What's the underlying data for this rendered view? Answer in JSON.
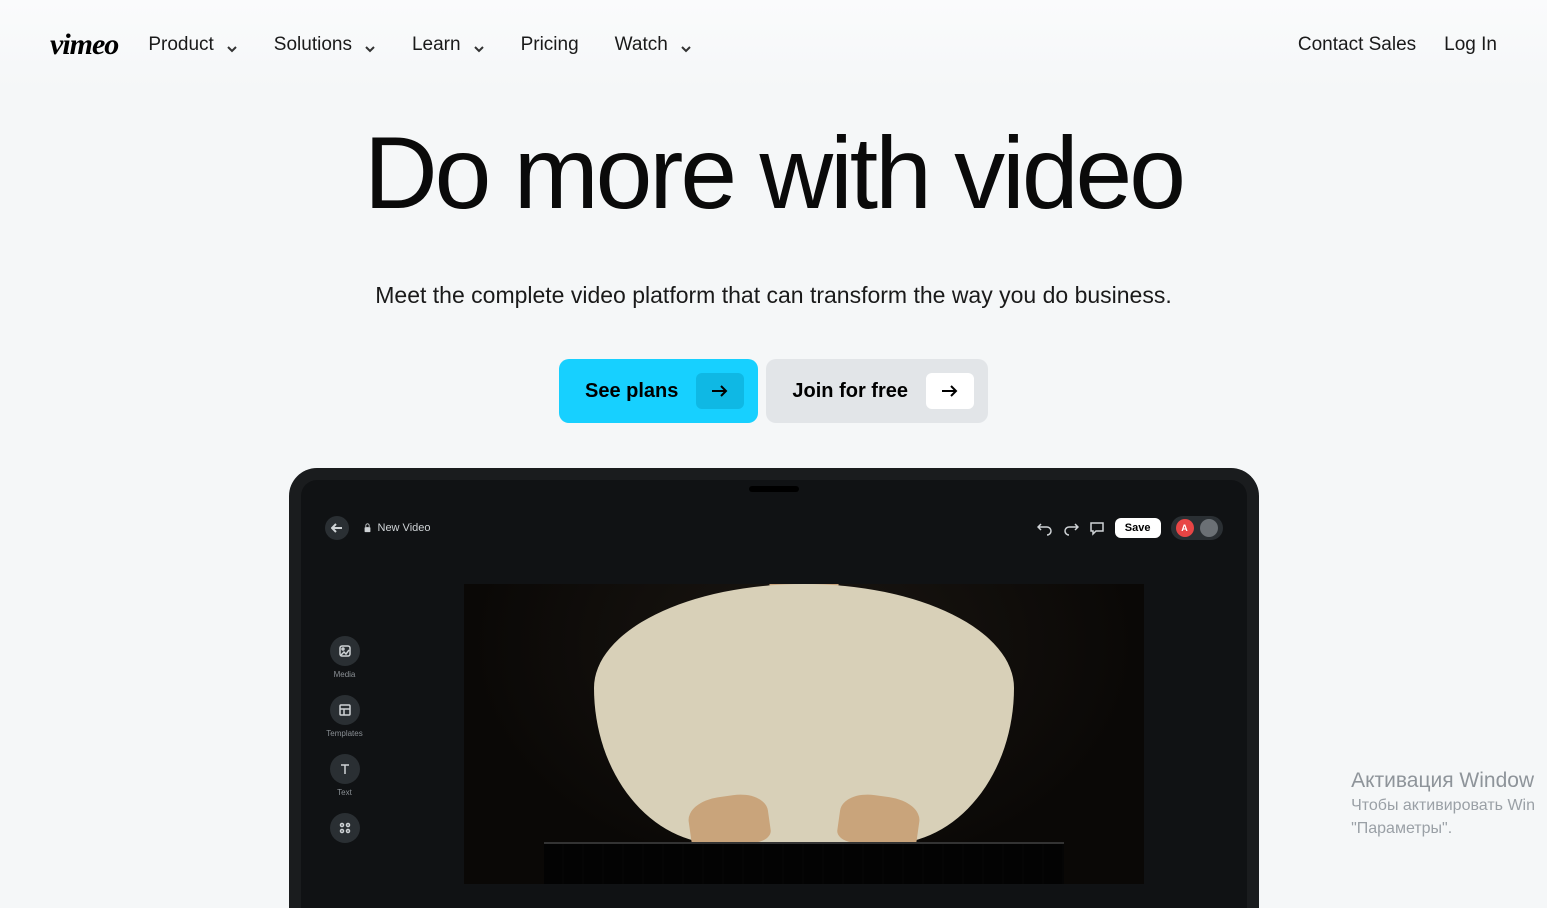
{
  "brand": "vimeo",
  "nav": {
    "items": [
      {
        "label": "Product",
        "has_dropdown": true
      },
      {
        "label": "Solutions",
        "has_dropdown": true
      },
      {
        "label": "Learn",
        "has_dropdown": true
      },
      {
        "label": "Pricing",
        "has_dropdown": false
      },
      {
        "label": "Watch",
        "has_dropdown": true
      }
    ]
  },
  "header_links": {
    "contact_sales": "Contact Sales",
    "log_in": "Log In"
  },
  "hero": {
    "title": "Do more with video",
    "subtitle": "Meet the complete video platform that can transform the way you do business.",
    "cta_primary": "See plans",
    "cta_secondary": "Join for free"
  },
  "editor": {
    "file_title": "New Video",
    "save_label": "Save",
    "avatar_initial": "A",
    "sidebar": [
      {
        "label": "Media",
        "icon": "media"
      },
      {
        "label": "Templates",
        "icon": "templates"
      },
      {
        "label": "Text",
        "icon": "text"
      },
      {
        "label": "",
        "icon": "more"
      }
    ]
  },
  "colors": {
    "accent": "#17d0ff",
    "accent_dark": "#0fb8e4",
    "secondary": "#e2e5e8",
    "device": "#101214",
    "editor_icon_bg": "#2a2f33"
  },
  "watermark": {
    "title": "Активация Window",
    "line1": "Чтобы активировать Win",
    "line2": "\"Параметры\"."
  }
}
